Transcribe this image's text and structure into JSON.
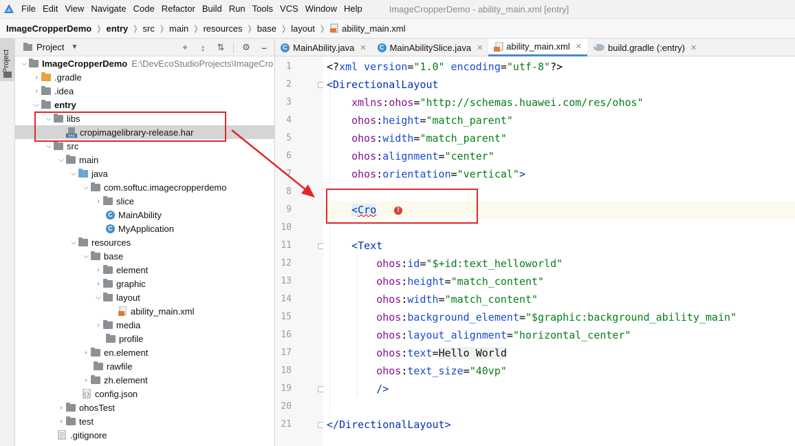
{
  "menubar": {
    "items": [
      "File",
      "Edit",
      "View",
      "Navigate",
      "Code",
      "Refactor",
      "Build",
      "Run",
      "Tools",
      "VCS",
      "Window",
      "Help"
    ],
    "title": "ImageCropperDemo - ability_main.xml [entry]"
  },
  "breadcrumb": [
    "ImageCropperDemo",
    "entry",
    "src",
    "main",
    "resources",
    "base",
    "layout",
    "ability_main.xml"
  ],
  "toolstrip": {
    "label": "Project"
  },
  "project_panel": {
    "title": "Project",
    "root_name": "ImageCropperDemo",
    "root_path": "E:\\DevEcoStudioProjects\\ImageCro",
    "items": [
      ".gradle",
      ".idea",
      "entry",
      "libs",
      "cropimagelibrary-release.har",
      "src",
      "main",
      "java",
      "com.softuc.imagecropperdemo",
      "slice",
      "MainAbility",
      "MyApplication",
      "resources",
      "base",
      "element",
      "graphic",
      "layout",
      "ability_main.xml",
      "media",
      "profile",
      "en.element",
      "rawfile",
      "zh.element",
      "config.json",
      "ohosTest",
      "test",
      ".gitignore"
    ]
  },
  "editor_tabs": [
    {
      "label": "MainAbility.java",
      "icon": "class-icon"
    },
    {
      "label": "MainAbilitySlice.java",
      "icon": "class-icon"
    },
    {
      "label": "ability_main.xml",
      "icon": "xml-file-icon"
    },
    {
      "label": "build.gradle (:entry)",
      "icon": "gradle-icon"
    }
  ],
  "line_numbers": [
    "1",
    "2",
    "3",
    "4",
    "5",
    "6",
    "7",
    "8",
    "9",
    "10",
    "11",
    "12",
    "13",
    "14",
    "15",
    "16",
    "17",
    "18",
    "19",
    "20",
    "21"
  ],
  "code": {
    "l1": {
      "a": "<?",
      "b": "xml version",
      "c": "=",
      "d": "\"1.0\"",
      "e": " encoding",
      "f": "=",
      "g": "\"utf-8\"",
      "h": "?>"
    },
    "l2": {
      "a": "<",
      "b": "DirectionalLayout"
    },
    "l3": {
      "ns": "xmlns",
      "colon": ":",
      "attr": "ohos",
      "eq": "=",
      "val": "\"http://schemas.huawei.com/res/ohos\""
    },
    "l4": {
      "ns": "ohos",
      "colon": ":",
      "attr": "height",
      "eq": "=",
      "val": "\"match_parent\""
    },
    "l5": {
      "ns": "ohos",
      "colon": ":",
      "attr": "width",
      "eq": "=",
      "val": "\"match_parent\""
    },
    "l6": {
      "ns": "ohos",
      "colon": ":",
      "attr": "alignment",
      "eq": "=",
      "val": "\"center\""
    },
    "l7": {
      "ns": "ohos",
      "colon": ":",
      "attr": "orientation",
      "eq": "=",
      "val": "\"vertical\"",
      "end": ">"
    },
    "l9": {
      "lt": "<",
      "tag": "Cro",
      "err": "!"
    },
    "l11": {
      "lt": "<",
      "tag": "Text"
    },
    "l12": {
      "ns": "ohos",
      "colon": ":",
      "attr": "id",
      "eq": "=",
      "val": "\"$+id:text_helloworld\""
    },
    "l13": {
      "ns": "ohos",
      "colon": ":",
      "attr": "height",
      "eq": "=",
      "val": "\"match_content\""
    },
    "l14": {
      "ns": "ohos",
      "colon": ":",
      "attr": "width",
      "eq": "=",
      "val": "\"match_content\""
    },
    "l15": {
      "ns": "ohos",
      "colon": ":",
      "attr": "background_element",
      "eq": "=",
      "val": "\"$graphic:background_ability_main\""
    },
    "l16": {
      "ns": "ohos",
      "colon": ":",
      "attr": "layout_alignment",
      "eq": "=",
      "val": "\"horizontal_center\""
    },
    "l17": {
      "ns": "ohos",
      "colon": ":",
      "attr": "text",
      "eq": "=",
      "val": "Hello World"
    },
    "l18": {
      "ns": "ohos",
      "colon": ":",
      "attr": "text_size",
      "eq": "=",
      "val": "\"40vp\""
    },
    "l19": {
      "end": "/>"
    },
    "l21": {
      "a": "</",
      "b": "DirectionalLayout",
      "c": ">"
    }
  },
  "colors": {
    "annotation": "#e02828",
    "tag": "#0033b3",
    "namespace": "#871094",
    "attribute": "#174ad4",
    "string": "#067d17",
    "active_tab_underline": "#4a88c7"
  }
}
